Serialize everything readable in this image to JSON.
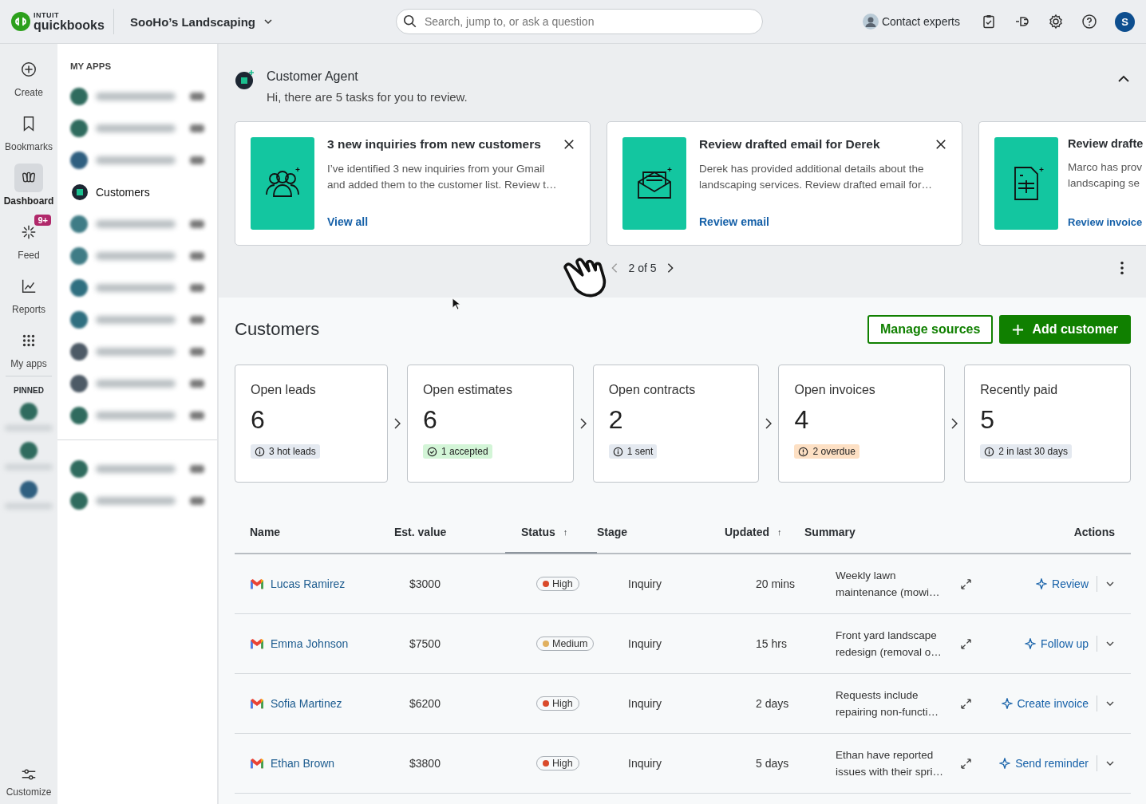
{
  "topbar": {
    "brand_top": "INTUIT",
    "brand": "quickbooks",
    "company": "SooHo’s Landscaping",
    "search": {
      "placeholder": "Search, jump to, or ask a question"
    },
    "contact": "Contact experts",
    "avatar_letter": "S"
  },
  "rail": {
    "items": [
      {
        "kind": "create",
        "label": "Create",
        "selected": false
      },
      {
        "kind": "bookmarks",
        "label": "Bookmarks",
        "selected": false
      },
      {
        "kind": "dashboard",
        "label": "Dashboard",
        "selected": true
      },
      {
        "kind": "feed",
        "label": "Feed",
        "selected": false,
        "badge": "9+"
      },
      {
        "kind": "reports",
        "label": "Reports",
        "selected": false
      },
      {
        "kind": "apps",
        "label": "My apps",
        "selected": false
      }
    ],
    "pinned_title": "PINNED",
    "pinned": [
      {
        "color": "#2f6b5e"
      },
      {
        "color": "#2f6b5e"
      },
      {
        "color": "#2f5f80"
      }
    ],
    "customize": "Customize"
  },
  "apps_panel": {
    "title": "MY APPS",
    "groups": [
      [
        {
          "kind": "blurred",
          "color": "#2f6b5e"
        },
        {
          "kind": "blurred",
          "color": "#2f6b5e"
        },
        {
          "kind": "blurred",
          "color": "#2f5f80"
        },
        {
          "kind": "app",
          "label": "Customers",
          "selected": true
        },
        {
          "kind": "blurred",
          "color": "#3f7c86"
        },
        {
          "kind": "blurred",
          "color": "#3f7c86"
        },
        {
          "kind": "blurred",
          "color": "#2f6f80"
        },
        {
          "kind": "blurred",
          "color": "#2f6f80"
        },
        {
          "kind": "blurred",
          "color": "#4d5a66"
        },
        {
          "kind": "blurred",
          "color": "#4d5a66"
        },
        {
          "kind": "blurred",
          "color": "#2f6b5e"
        }
      ],
      [
        {
          "kind": "blurred",
          "color": "#2f6b5e"
        },
        {
          "kind": "blurred",
          "color": "#2f6b5e"
        }
      ]
    ]
  },
  "agent": {
    "title": "Customer Agent",
    "subtitle": "Hi, there are 5 tasks for you to review.",
    "cards": [
      {
        "kind": "people",
        "title": "3 new inquiries from new customers",
        "text": [
          "I’ve identified 3 new inquiries from your Gmail",
          "and added them to the customer list. Review t…"
        ],
        "link": "View all",
        "closable": true
      },
      {
        "kind": "email",
        "title": "Review drafted email for Derek",
        "text": [
          "Derek has provided additional details about the",
          "landscaping services. Review drafted email for…"
        ],
        "link": "Review email",
        "closable": true
      },
      {
        "kind": "invoice",
        "title": "Review drafte",
        "text": [
          "Marco has prov",
          "landscaping se"
        ],
        "link": "Review invoice",
        "closable": false
      }
    ],
    "pager": "2 of 5"
  },
  "customers": {
    "title": "Customers",
    "buttons": [
      {
        "kind": "outline",
        "label": "Manage sources"
      },
      {
        "kind": "primary",
        "label": "Add customer"
      }
    ],
    "stats": [
      {
        "label": "Open leads",
        "value": "6",
        "note": "3 hot leads",
        "kind": "info"
      },
      {
        "label": "Open estimates",
        "value": "6",
        "note": "1 accepted",
        "kind": "success"
      },
      {
        "label": "Open contracts",
        "value": "2",
        "note": "1 sent",
        "kind": "info"
      },
      {
        "label": "Open invoices",
        "value": "4",
        "note": "2 overdue",
        "kind": "warning"
      },
      {
        "label": "Recently paid",
        "value": "5",
        "note": "2 in last 30 days",
        "kind": "info"
      }
    ],
    "table": {
      "columns": [
        {
          "label": "Name",
          "selected": false
        },
        {
          "label": "Est. value",
          "selected": false
        },
        {
          "label": "Status",
          "sort": "↑",
          "selected": true
        },
        {
          "label": "Stage",
          "selected": false
        },
        {
          "label": "Updated",
          "sort": "↑",
          "selected": false
        },
        {
          "label": "Summary",
          "selected": false
        },
        {
          "label": "Actions",
          "selected": false
        }
      ],
      "rows": [
        {
          "name": "Lucas Ramirez",
          "value": "$3000",
          "status": {
            "label": "High",
            "color": "#d94a2b"
          },
          "stage": "Inquiry",
          "updated": "20 mins",
          "summary": [
            "Weekly lawn",
            "maintenance (mowi…"
          ],
          "action": "Review"
        },
        {
          "name": "Emma Johnson",
          "value": "$7500",
          "status": {
            "label": "Medium",
            "color": "#e0b060"
          },
          "stage": "Inquiry",
          "updated": "15 hrs",
          "summary": [
            "Front yard landscape",
            "redesign (removal o…"
          ],
          "action": "Follow up"
        },
        {
          "name": "Sofia Martinez",
          "value": "$6200",
          "status": {
            "label": "High",
            "color": "#d94a2b"
          },
          "stage": "Inquiry",
          "updated": "2 days",
          "summary": [
            "Requests include",
            "repairing non-functi…"
          ],
          "action": "Create invoice"
        },
        {
          "name": "Ethan Brown",
          "value": "$3800",
          "status": {
            "label": "High",
            "color": "#d94a2b"
          },
          "stage": "Inquiry",
          "updated": "5 days",
          "summary": [
            "Ethan have reported",
            "issues with their spri…"
          ],
          "action": "Send reminder"
        }
      ]
    }
  }
}
